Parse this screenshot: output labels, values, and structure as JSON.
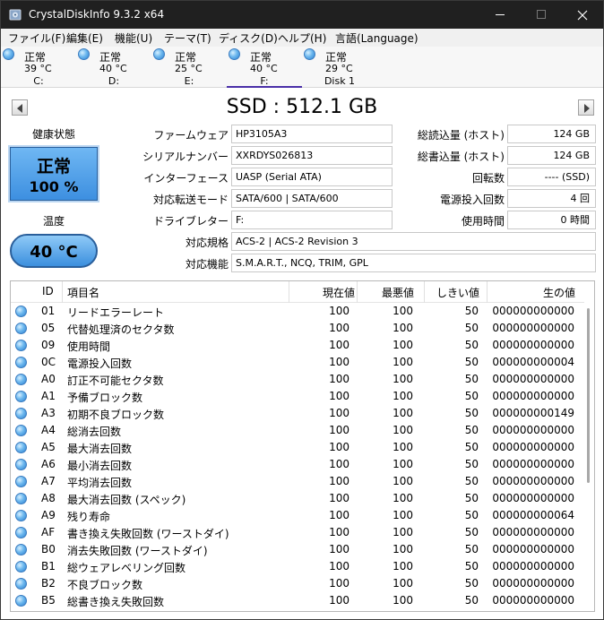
{
  "window": {
    "title": "CrystalDiskInfo 9.3.2 x64"
  },
  "menu": [
    "ファイル(F)",
    "編集(E)",
    "機能(U)",
    "テーマ(T)",
    "ディスク(D)",
    "ヘルプ(H)",
    "言語(Language)"
  ],
  "drives": [
    {
      "status": "正常",
      "temp": "39 °C",
      "label": "C:",
      "selected": false
    },
    {
      "status": "正常",
      "temp": "40 °C",
      "label": "D:",
      "selected": false
    },
    {
      "status": "正常",
      "temp": "25 °C",
      "label": "E:",
      "selected": false
    },
    {
      "status": "正常",
      "temp": "40 °C",
      "label": "F:",
      "selected": true
    },
    {
      "status": "正常",
      "temp": "29 °C",
      "label": "Disk 1",
      "selected": false
    }
  ],
  "disk": {
    "title": "SSD : 512.1 GB"
  },
  "health": {
    "label": "健康状態",
    "status": "正常",
    "percent": "100 %"
  },
  "temperature": {
    "label": "温度",
    "value": "40 °C"
  },
  "info": {
    "firmware_label": "ファームウェア",
    "firmware": "HP3105A3",
    "serial_label": "シリアルナンバー",
    "serial": "XXRDYS026813",
    "interface_label": "インターフェース",
    "interface": "UASP (Serial ATA)",
    "transfer_label": "対応転送モード",
    "transfer": "SATA/600 | SATA/600",
    "letter_label": "ドライブレター",
    "letter": "F:",
    "standard_label": "対応規格",
    "standard": "ACS-2 | ACS-2 Revision 3",
    "features_label": "対応機能",
    "features": "S.M.A.R.T., NCQ, TRIM, GPL",
    "host_reads_label": "総読込量 (ホスト)",
    "host_reads": "124 GB",
    "host_writes_label": "総書込量 (ホスト)",
    "host_writes": "124 GB",
    "rotation_label": "回転数",
    "rotation": "---- (SSD)",
    "power_count_label": "電源投入回数",
    "power_count": "4 回",
    "power_hours_label": "使用時間",
    "power_hours": "0 時間"
  },
  "smart": {
    "headers": {
      "id": "ID",
      "name": "項目名",
      "current": "現在値",
      "worst": "最悪値",
      "threshold": "しきい値",
      "raw": "生の値"
    },
    "rows": [
      {
        "id": "01",
        "name": "リードエラーレート",
        "current": "100",
        "worst": "100",
        "threshold": "50",
        "raw": "000000000000"
      },
      {
        "id": "05",
        "name": "代替処理済のセクタ数",
        "current": "100",
        "worst": "100",
        "threshold": "50",
        "raw": "000000000000"
      },
      {
        "id": "09",
        "name": "使用時間",
        "current": "100",
        "worst": "100",
        "threshold": "50",
        "raw": "000000000000"
      },
      {
        "id": "0C",
        "name": "電源投入回数",
        "current": "100",
        "worst": "100",
        "threshold": "50",
        "raw": "000000000004"
      },
      {
        "id": "A0",
        "name": "訂正不可能セクタ数",
        "current": "100",
        "worst": "100",
        "threshold": "50",
        "raw": "000000000000"
      },
      {
        "id": "A1",
        "name": "予備ブロック数",
        "current": "100",
        "worst": "100",
        "threshold": "50",
        "raw": "000000000000"
      },
      {
        "id": "A3",
        "name": "初期不良ブロック数",
        "current": "100",
        "worst": "100",
        "threshold": "50",
        "raw": "000000000149"
      },
      {
        "id": "A4",
        "name": "総消去回数",
        "current": "100",
        "worst": "100",
        "threshold": "50",
        "raw": "000000000000"
      },
      {
        "id": "A5",
        "name": "最大消去回数",
        "current": "100",
        "worst": "100",
        "threshold": "50",
        "raw": "000000000000"
      },
      {
        "id": "A6",
        "name": "最小消去回数",
        "current": "100",
        "worst": "100",
        "threshold": "50",
        "raw": "000000000000"
      },
      {
        "id": "A7",
        "name": "平均消去回数",
        "current": "100",
        "worst": "100",
        "threshold": "50",
        "raw": "000000000000"
      },
      {
        "id": "A8",
        "name": "最大消去回数 (スペック)",
        "current": "100",
        "worst": "100",
        "threshold": "50",
        "raw": "000000000000"
      },
      {
        "id": "A9",
        "name": "残り寿命",
        "current": "100",
        "worst": "100",
        "threshold": "50",
        "raw": "000000000064"
      },
      {
        "id": "AF",
        "name": "書き換え失敗回数 (ワーストダイ)",
        "current": "100",
        "worst": "100",
        "threshold": "50",
        "raw": "000000000000"
      },
      {
        "id": "B0",
        "name": "消去失敗回数 (ワーストダイ)",
        "current": "100",
        "worst": "100",
        "threshold": "50",
        "raw": "000000000000"
      },
      {
        "id": "B1",
        "name": "総ウェアレベリング回数",
        "current": "100",
        "worst": "100",
        "threshold": "50",
        "raw": "000000000000"
      },
      {
        "id": "B2",
        "name": "不良ブロック数",
        "current": "100",
        "worst": "100",
        "threshold": "50",
        "raw": "000000000000"
      },
      {
        "id": "B5",
        "name": "総書き換え失敗回数",
        "current": "100",
        "worst": "100",
        "threshold": "50",
        "raw": "000000000000"
      }
    ]
  }
}
